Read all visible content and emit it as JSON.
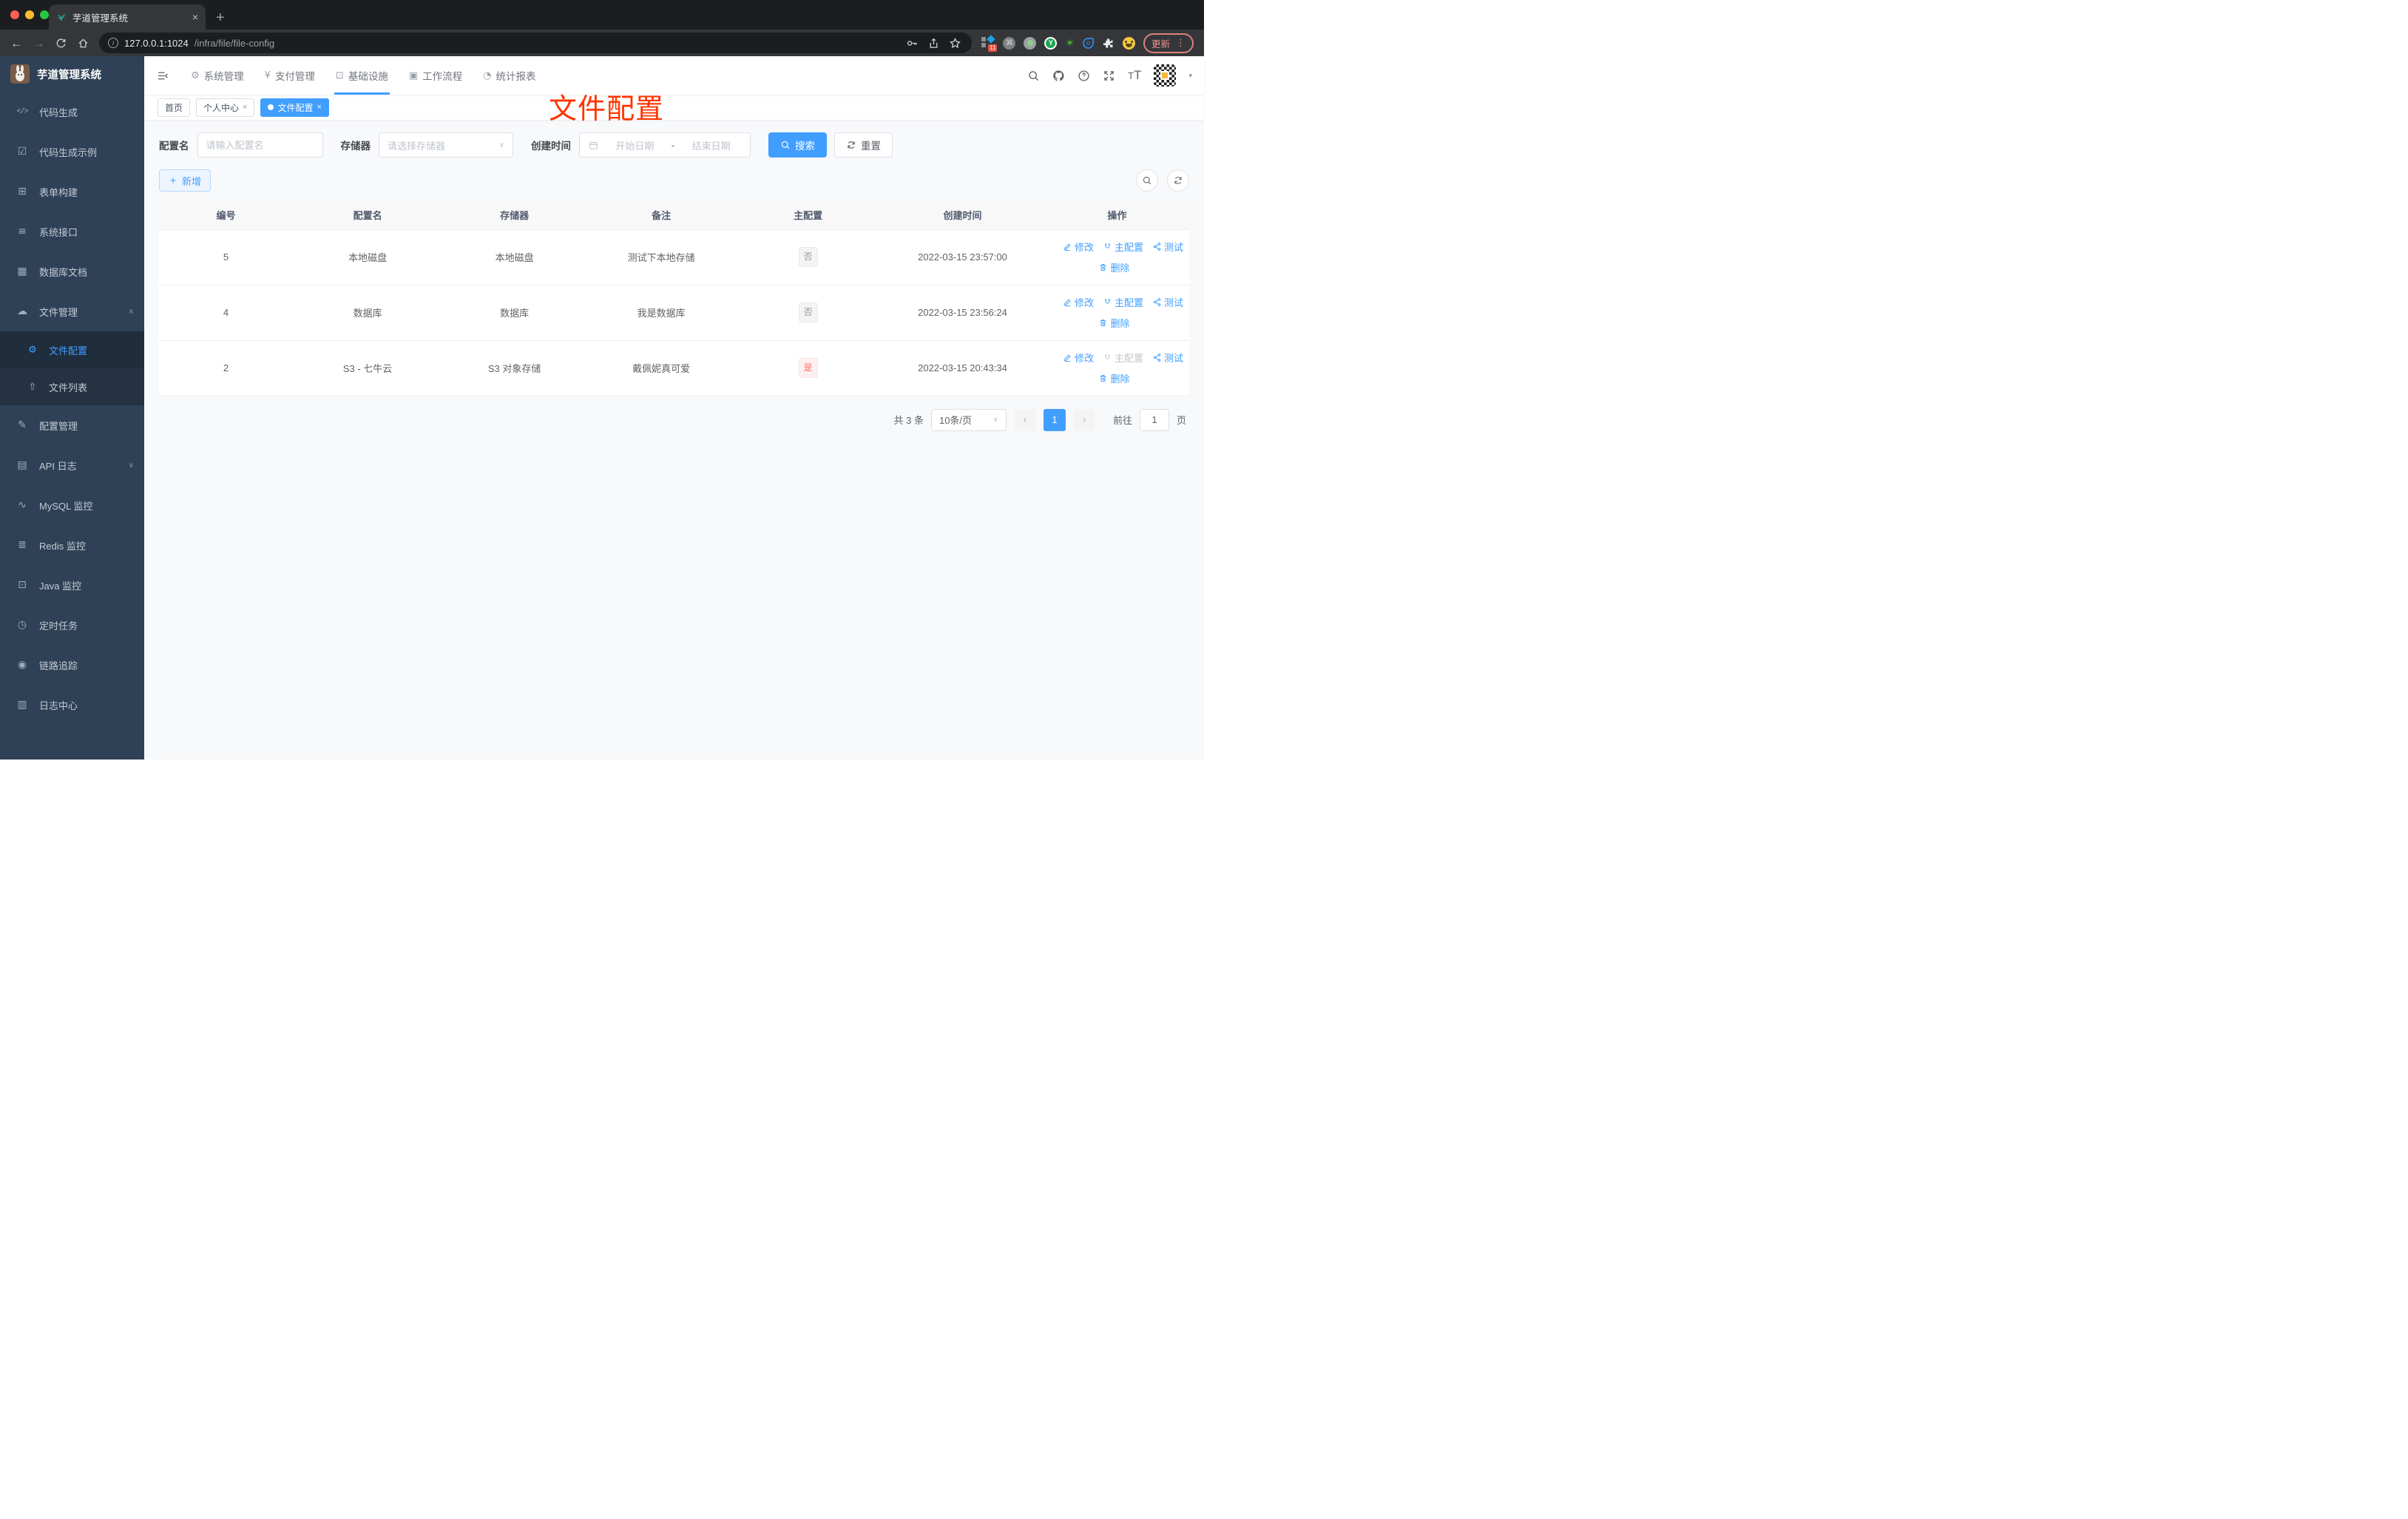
{
  "colors": {
    "accent": "#409eff",
    "danger": "#f56c6c",
    "annotation_red": "#ff3400",
    "sidebar_bg": "#2f4156"
  },
  "browser": {
    "tab_title": "芋道管理系统",
    "url_host": "127.0.0.1:1024",
    "url_path": "/infra/file/file-config",
    "extensions_badge": "11",
    "update_label": "更新"
  },
  "icons": {
    "code": "</>",
    "example": "☑",
    "form": "⊞",
    "api": "≡",
    "dbdoc": "▦",
    "file": "☁",
    "gear": "⚙",
    "upload": "⇧",
    "edit": "✎",
    "apilog": "▤",
    "mysql": "∿",
    "redis": "≣",
    "java": "⊡",
    "job": "◷",
    "trace": "◉",
    "logcenter": "▥",
    "sys": "⚙",
    "pay": "¥",
    "infra": "⊡",
    "workflow": "▣",
    "report": "◔",
    "chev_up": "∧",
    "chev_down": "∨",
    "caret_down": "▾",
    "close": "×",
    "prev": "‹",
    "next": "›",
    "back": "←",
    "forward": "→"
  },
  "sidebar": {
    "title": "芋道管理系统",
    "items_top": [
      {
        "label": "代码生成"
      },
      {
        "label": "代码生成示例"
      },
      {
        "label": "表单构建"
      },
      {
        "label": "系统接口"
      },
      {
        "label": "数据库文档"
      },
      {
        "label": "文件管理"
      }
    ],
    "sub_items": [
      {
        "label": "文件配置"
      },
      {
        "label": "文件列表"
      }
    ],
    "items_bottom": [
      {
        "label": "配置管理"
      },
      {
        "label": "API 日志"
      },
      {
        "label": "MySQL 监控"
      },
      {
        "label": "Redis 监控"
      },
      {
        "label": "Java 监控"
      },
      {
        "label": "定时任务"
      },
      {
        "label": "链路追踪"
      },
      {
        "label": "日志中心"
      }
    ]
  },
  "topnav": {
    "items": [
      {
        "label": "系统管理"
      },
      {
        "label": "支付管理"
      },
      {
        "label": "基础设施"
      },
      {
        "label": "工作流程"
      },
      {
        "label": "统计报表"
      }
    ]
  },
  "tags": [
    {
      "label": "首页"
    },
    {
      "label": "个人中心"
    },
    {
      "label": "文件配置"
    }
  ],
  "annotation_title": "文件配置",
  "filters": {
    "config_name_label": "配置名",
    "config_name_placeholder": "请输入配置名",
    "storage_label": "存储器",
    "storage_placeholder": "请选择存储器",
    "create_time_label": "创建时间",
    "date_start_placeholder": "开始日期",
    "date_separator": "-",
    "date_end_placeholder": "结束日期",
    "search_label": "搜索",
    "reset_label": "重置"
  },
  "toolbar": {
    "add_label": "新增"
  },
  "table": {
    "headers": [
      "编号",
      "配置名",
      "存储器",
      "备注",
      "主配置",
      "创建时间",
      "操作"
    ],
    "action_labels": {
      "edit": "修改",
      "master": "主配置",
      "test": "测试",
      "del": "删除"
    },
    "rows": [
      {
        "id": "5",
        "name": "本地磁盘",
        "storage": "本地磁盘",
        "remark": "测试下本地存储",
        "master": "否",
        "created": "2022-03-15 23:57:00"
      },
      {
        "id": "4",
        "name": "数据库",
        "storage": "数据库",
        "remark": "我是数据库",
        "master": "否",
        "created": "2022-03-15 23:56:24"
      },
      {
        "id": "2",
        "name": "S3 - 七牛云",
        "storage": "S3 对象存储",
        "remark": "戴佩妮真可爱",
        "master": "是",
        "created": "2022-03-15 20:43:34"
      }
    ]
  },
  "pagination": {
    "total": "共 3 条",
    "page_size": "10条/页",
    "current": "1",
    "goto_label": "前往",
    "goto_value": "1",
    "page_label": "页"
  }
}
